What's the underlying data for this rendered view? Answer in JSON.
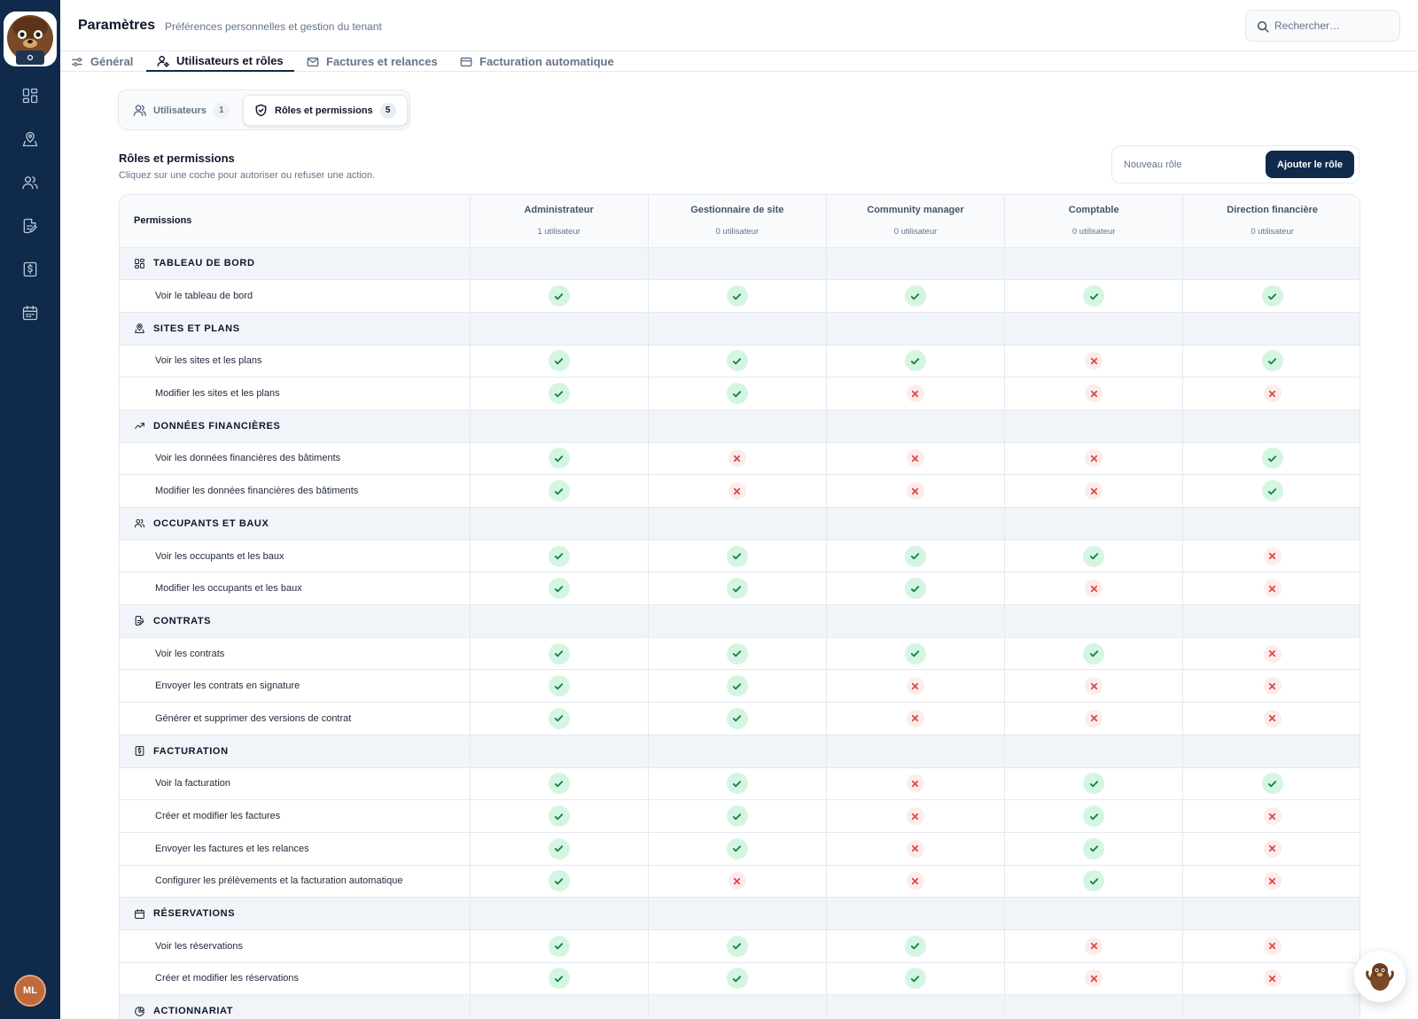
{
  "app": {
    "title": "Paramètres",
    "subtitle": "Préférences personnelles et gestion du tenant",
    "search_placeholder": "Rechercher…",
    "user_initials": "ML"
  },
  "sidebar": {
    "items": [
      {
        "icon": "dashboard-grid-icon"
      },
      {
        "icon": "map-pin-icon"
      },
      {
        "icon": "users-icon"
      },
      {
        "icon": "contract-edit-icon"
      },
      {
        "icon": "invoice-dollar-icon"
      },
      {
        "icon": "calendar-icon"
      }
    ]
  },
  "tabs": [
    {
      "label": "Général",
      "icon": "sliders-icon",
      "active": false
    },
    {
      "label": "Utilisateurs et rôles",
      "icon": "user-gear-icon",
      "active": true
    },
    {
      "label": "Factures et relances",
      "icon": "mail-icon",
      "active": false
    },
    {
      "label": "Facturation automatique",
      "icon": "credit-card-icon",
      "active": false
    }
  ],
  "subtabs": [
    {
      "label": "Utilisateurs",
      "count": "1",
      "icon": "users-icon",
      "active": false
    },
    {
      "label": "Rôles et permissions",
      "count": "5",
      "icon": "shield-icon",
      "active": true
    }
  ],
  "section": {
    "title": "Rôles et permissions",
    "description": "Cliquez sur une coche pour autoriser ou refuser une action.",
    "new_role_placeholder": "Nouveau rôle",
    "add_button_label": "Ajouter le rôle"
  },
  "table": {
    "permissions_header": "Permissions",
    "roles": [
      {
        "name": "Administrateur",
        "users": "1 utilisateur"
      },
      {
        "name": "Gestionnaire de site",
        "users": "0 utilisateur"
      },
      {
        "name": "Community manager",
        "users": "0 utilisateur"
      },
      {
        "name": "Comptable",
        "users": "0 utilisateur"
      },
      {
        "name": "Direction financière",
        "users": "0 utilisateur"
      }
    ],
    "categories": [
      {
        "name": "TABLEAU DE BORD",
        "icon": "dashboard-grid-icon",
        "permissions": [
          {
            "label": "Voir le tableau de bord",
            "grants": [
              true,
              true,
              true,
              true,
              true
            ]
          }
        ]
      },
      {
        "name": "SITES ET PLANS",
        "icon": "map-pin-icon",
        "permissions": [
          {
            "label": "Voir les sites et les plans",
            "grants": [
              true,
              true,
              true,
              false,
              true
            ]
          },
          {
            "label": "Modifier les sites et les plans",
            "grants": [
              true,
              true,
              false,
              false,
              false
            ]
          }
        ]
      },
      {
        "name": "DONNÉES FINANCIÈRES",
        "icon": "trending-up-icon",
        "permissions": [
          {
            "label": "Voir les données financières des bâtiments",
            "grants": [
              true,
              false,
              false,
              false,
              true
            ]
          },
          {
            "label": "Modifier les données financières des bâtiments",
            "grants": [
              true,
              false,
              false,
              false,
              true
            ]
          }
        ]
      },
      {
        "name": "OCCUPANTS ET BAUX",
        "icon": "users-icon",
        "permissions": [
          {
            "label": "Voir les occupants et les baux",
            "grants": [
              true,
              true,
              true,
              true,
              false
            ]
          },
          {
            "label": "Modifier les occupants et les baux",
            "grants": [
              true,
              true,
              true,
              false,
              false
            ]
          }
        ]
      },
      {
        "name": "CONTRATS",
        "icon": "contract-edit-icon",
        "permissions": [
          {
            "label": "Voir les contrats",
            "grants": [
              true,
              true,
              true,
              true,
              false
            ]
          },
          {
            "label": "Envoyer les contrats en signature",
            "grants": [
              true,
              true,
              false,
              false,
              false
            ]
          },
          {
            "label": "Générer et supprimer des versions de contrat",
            "grants": [
              true,
              true,
              false,
              false,
              false
            ]
          }
        ]
      },
      {
        "name": "FACTURATION",
        "icon": "invoice-dollar-icon",
        "permissions": [
          {
            "label": "Voir la facturation",
            "grants": [
              true,
              true,
              false,
              true,
              true
            ]
          },
          {
            "label": "Créer et modifier les factures",
            "grants": [
              true,
              true,
              false,
              true,
              false
            ]
          },
          {
            "label": "Envoyer les factures et les relances",
            "grants": [
              true,
              true,
              false,
              true,
              false
            ]
          },
          {
            "label": "Configurer les prélèvements et la facturation automatique",
            "grants": [
              true,
              false,
              false,
              true,
              false
            ]
          }
        ]
      },
      {
        "name": "RÉSERVATIONS",
        "icon": "calendar-icon",
        "permissions": [
          {
            "label": "Voir les réservations",
            "grants": [
              true,
              true,
              true,
              false,
              false
            ]
          },
          {
            "label": "Créer et modifier les réservations",
            "grants": [
              true,
              true,
              true,
              false,
              false
            ]
          }
        ]
      },
      {
        "name": "ACTIONNARIAT",
        "icon": "pie-chart-icon",
        "permissions": []
      }
    ]
  },
  "colors": {
    "sidebar": "#0f2a4a",
    "accent": "#0f2a4a",
    "granted": "#16834a",
    "granted_bg": "#d5f5e3",
    "denied": "#e04848",
    "denied_bg": "#fdecec"
  }
}
